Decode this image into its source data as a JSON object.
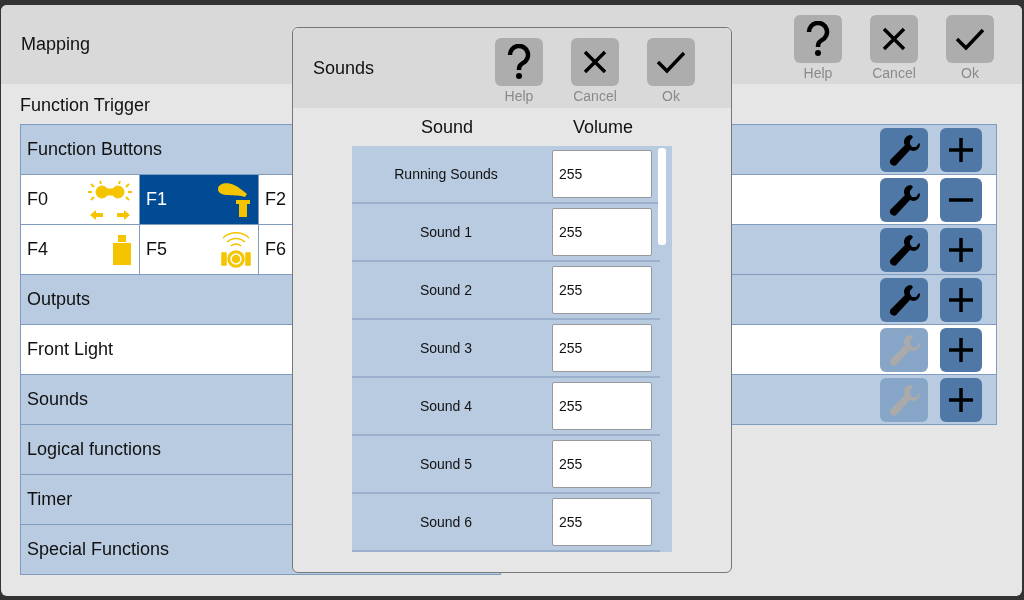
{
  "window": {
    "title": "Mapping",
    "buttons": [
      {
        "kind": "help",
        "label": "Help"
      },
      {
        "kind": "cancel",
        "label": "Cancel"
      },
      {
        "kind": "ok",
        "label": "Ok"
      }
    ]
  },
  "section_title": "Function Trigger",
  "rows": [
    {
      "kind": "label",
      "label": "Function Buttons",
      "selected": false,
      "action": {
        "edit_disabled": false,
        "assigned": false
      }
    },
    {
      "kind": "buttons",
      "selected": true,
      "cells": [
        {
          "label": "F0",
          "selected": false
        },
        {
          "label": "F1",
          "selected": true
        },
        {
          "label": "F2",
          "selected": false
        }
      ],
      "action": {
        "edit_disabled": false,
        "assigned": true
      }
    },
    {
      "kind": "buttons",
      "selected": false,
      "cells": [
        {
          "label": "F4",
          "selected": false
        },
        {
          "label": "F5",
          "selected": false
        },
        {
          "label": "F6",
          "selected": false
        }
      ],
      "action": {
        "edit_disabled": false,
        "assigned": false
      }
    },
    {
      "kind": "label",
      "label": "Outputs",
      "selected": false,
      "action": {
        "edit_disabled": false,
        "assigned": false
      }
    },
    {
      "kind": "label",
      "label": "Front Light",
      "selected": true,
      "action": {
        "edit_disabled": true,
        "assigned": false
      }
    },
    {
      "kind": "label",
      "label": "Sounds",
      "selected": false,
      "action": {
        "edit_disabled": true,
        "assigned": false
      }
    },
    {
      "kind": "label",
      "label": "Logical functions",
      "selected": false
    },
    {
      "kind": "label",
      "label": "Timer",
      "selected": false
    },
    {
      "kind": "label",
      "label": "Special Functions",
      "selected": false
    }
  ],
  "dialog": {
    "title": "Sounds",
    "buttons": [
      {
        "kind": "help",
        "label": "Help"
      },
      {
        "kind": "cancel",
        "label": "Cancel"
      },
      {
        "kind": "ok",
        "label": "Ok"
      }
    ],
    "columns": [
      "Sound",
      "Volume"
    ],
    "rows": [
      {
        "name": "Running Sounds",
        "volume": "255"
      },
      {
        "name": "Sound 1",
        "volume": "255"
      },
      {
        "name": "Sound 2",
        "volume": "255"
      },
      {
        "name": "Sound 3",
        "volume": "255"
      },
      {
        "name": "Sound 4",
        "volume": "255"
      },
      {
        "name": "Sound 5",
        "volume": "255"
      },
      {
        "name": "Sound 6",
        "volume": "255"
      }
    ]
  }
}
